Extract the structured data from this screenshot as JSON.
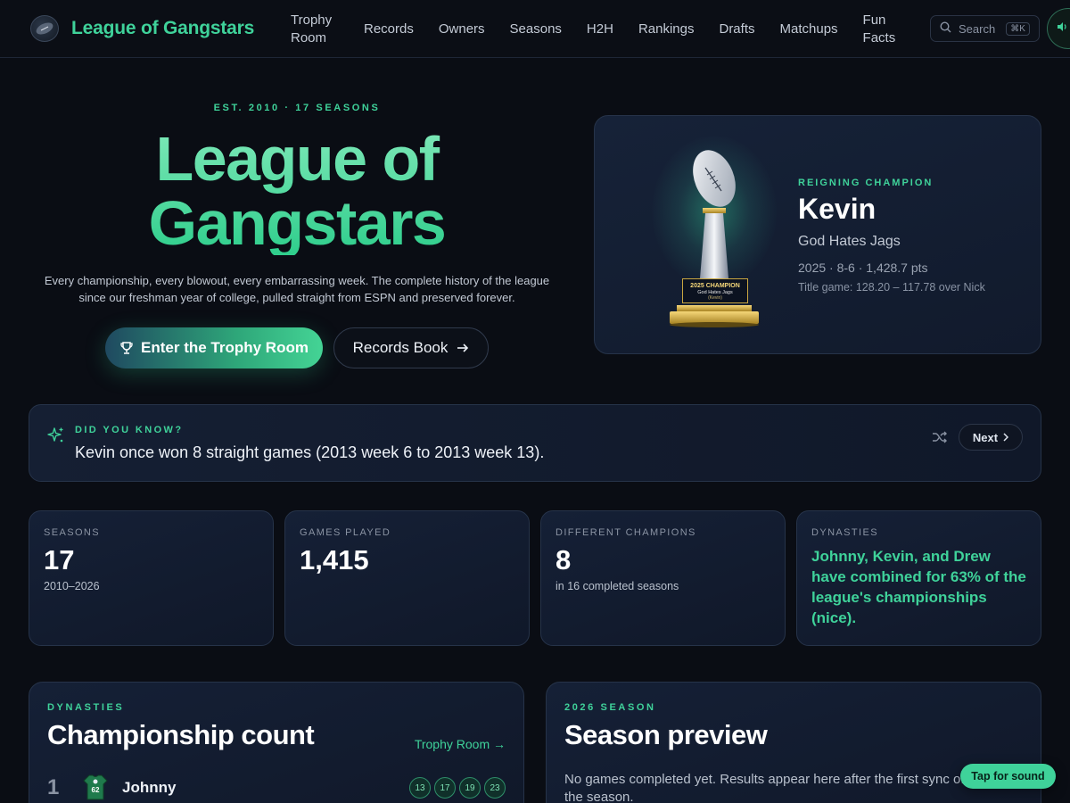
{
  "nav": {
    "brand": "League of Gangstars",
    "links": [
      {
        "label": "Trophy Room"
      },
      {
        "label": "Records"
      },
      {
        "label": "Owners"
      },
      {
        "label": "Seasons"
      },
      {
        "label": "H2H"
      },
      {
        "label": "Rankings"
      },
      {
        "label": "Drafts"
      },
      {
        "label": "Matchups"
      },
      {
        "label": "Fun Facts"
      }
    ],
    "search_label": "Search",
    "search_shortcut": "⌘K"
  },
  "hero": {
    "eyebrow": "EST. 2010 · 17 SEASONS",
    "title_line1": "League of",
    "title_line2": "Gangstars",
    "subtitle": "Every championship, every blowout, every embarrassing week. The complete history of the league since our freshman year of college, pulled straight from ESPN and preserved forever.",
    "primary_button": "Enter the Trophy Room",
    "secondary_button": "Records Book"
  },
  "champion": {
    "label": "REIGNING CHAMPION",
    "name": "Kevin",
    "team": "God Hates Jags",
    "stats": "2025 · 8-6 · 1,428.7 pts",
    "title_game": "Title game: 128.20 – 117.78 over Nick",
    "plate_line1": "2025 CHAMPION",
    "plate_line2": "God Hates Jags",
    "plate_line3": "(Kevin)"
  },
  "did_you_know": {
    "label": "DID YOU KNOW?",
    "text": "Kevin once won 8 straight games (2013 week 6 to 2013 week 13).",
    "next_label": "Next"
  },
  "stats": {
    "seasons": {
      "label": "SEASONS",
      "value": "17",
      "sub": "2010–2026"
    },
    "games": {
      "label": "GAMES PLAYED",
      "value": "1,415"
    },
    "champions": {
      "label": "DIFFERENT CHAMPIONS",
      "value": "8",
      "sub": "in 16 completed seasons"
    },
    "dynasties": {
      "label": "DYNASTIES",
      "text": "Johnny, Kevin, and Drew have combined for 63% of the league's championships (nice)."
    }
  },
  "championship_panel": {
    "eyebrow": "DYNASTIES",
    "title": "Championship count",
    "link": "Trophy Room →",
    "rows": [
      {
        "rank": "1",
        "name": "Johnny",
        "jersey": "62",
        "years": [
          "13",
          "17",
          "19",
          "23"
        ]
      }
    ]
  },
  "season_panel": {
    "eyebrow": "2026 SEASON",
    "title": "Season preview",
    "text": "No games completed yet. Results appear here after the first sync of the season."
  },
  "sound_toast": "Tap for sound",
  "colors": {
    "accent": "#3fd29a",
    "background": "#0a0d14",
    "card": "#152036"
  },
  "icons": [
    "football-icon",
    "search-icon",
    "speaker-icon",
    "trophy-icon",
    "arrow-right-icon",
    "sparkles-icon",
    "shuffle-icon",
    "chevron-right-icon"
  ]
}
